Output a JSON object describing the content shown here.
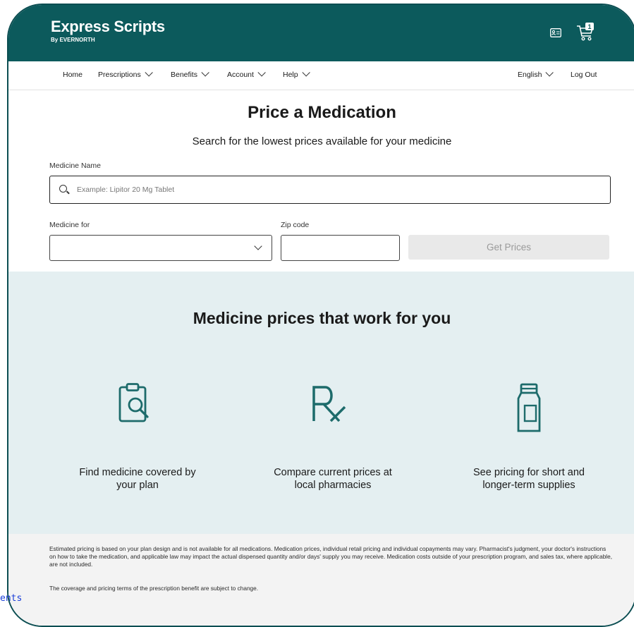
{
  "header": {
    "brand": "Express Scripts",
    "brand_sub": "By EVERNORTH",
    "cart_count": "1"
  },
  "nav": {
    "home": "Home",
    "prescriptions": "Prescriptions",
    "benefits": "Benefits",
    "account": "Account",
    "help": "Help",
    "language": "English",
    "logout": "Log Out"
  },
  "main": {
    "title": "Price a Medication",
    "subtitle": "Search for the lowest prices available for your medicine",
    "medicine_label": "Medicine Name",
    "medicine_placeholder": "Example: Lipitor 20 Mg Tablet",
    "for_label": "Medicine for",
    "zip_label": "Zip code",
    "button": "Get Prices"
  },
  "features": {
    "title": "Medicine prices that work for you",
    "items": [
      {
        "icon": "clipboard-search-icon",
        "text": "Find medicine covered by your plan"
      },
      {
        "icon": "rx-icon",
        "text": "Compare current prices at local pharmacies"
      },
      {
        "icon": "pill-bottle-icon",
        "text": "See pricing for short and longer-term supplies"
      }
    ]
  },
  "footer": {
    "disclaimer": "Estimated pricing is based on your plan design and is not available for all medications. Medication prices, individual retail pricing and individual copayments may vary. Pharmacist's judgment, your doctor's instructions on how to take the medication, and applicable law may impact the actual dispensed quantity and/or days' supply you may receive. Medication costs outside of your prescription program, and sales tax, where applicable, are not included.",
    "terms": "The coverage and pricing terms of the prescription benefit are subject to change."
  },
  "stray_text": "ents",
  "colors": {
    "brand": "#0c5a5c",
    "band": "#e4eff1",
    "icon": "#1d6b6b"
  }
}
